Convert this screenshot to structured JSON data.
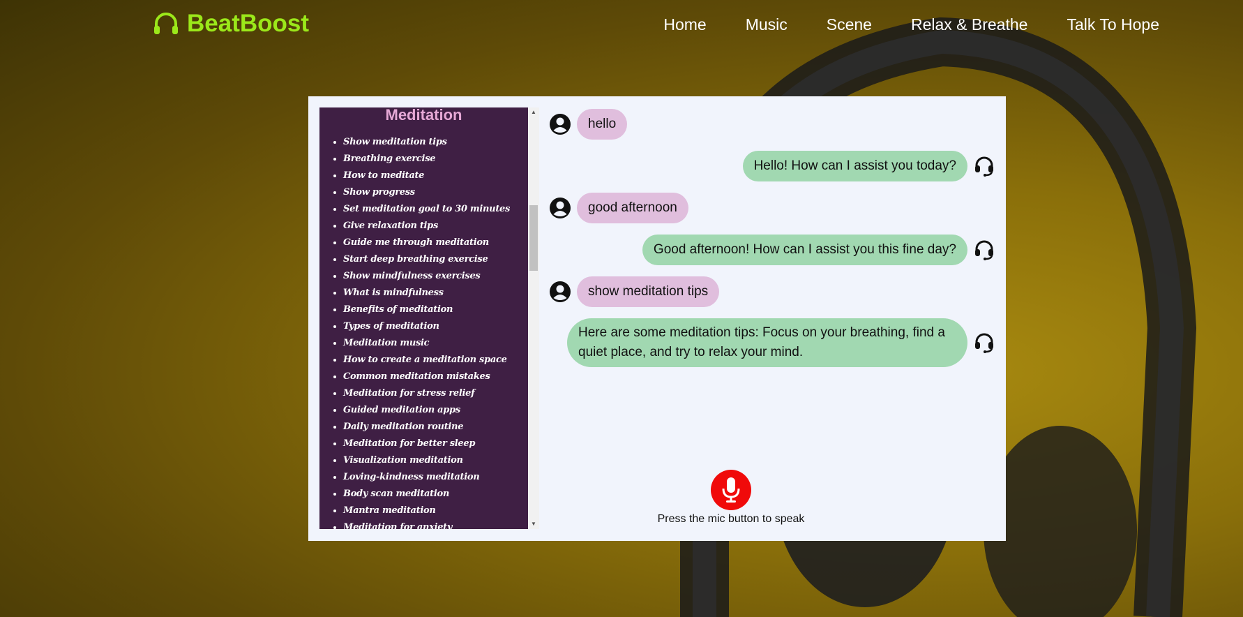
{
  "app": {
    "name": "BeatBoost",
    "logo_icon": "headphones-icon",
    "brand_color": "#9be81a"
  },
  "nav": {
    "items": [
      {
        "label": "Home"
      },
      {
        "label": "Music"
      },
      {
        "label": "Scene"
      },
      {
        "label": "Relax & Breathe"
      },
      {
        "label": "Talk To Hope"
      }
    ]
  },
  "sidebar": {
    "title": "Meditation",
    "items": [
      "Show meditation tips",
      "Breathing exercise",
      "How to meditate",
      "Show progress",
      "Set meditation goal to 30 minutes",
      "Give relaxation tips",
      "Guide me through meditation",
      "Start deep breathing exercise",
      "Show mindfulness exercises",
      "What is mindfulness",
      "Benefits of meditation",
      "Types of meditation",
      "Meditation music",
      "How to create a meditation space",
      "Common meditation mistakes",
      "Meditation for stress relief",
      "Guided meditation apps",
      "Daily meditation routine",
      "Meditation for better sleep",
      "Visualization meditation",
      "Loving-kindness meditation",
      "Body scan meditation",
      "Mantra meditation",
      "Meditation for anxiety"
    ]
  },
  "chat": {
    "messages": [
      {
        "from": "user",
        "text": "hello",
        "icon": "user-avatar-icon"
      },
      {
        "from": "bot",
        "text": "Hello! How can I assist you today?",
        "icon": "headset-icon"
      },
      {
        "from": "user",
        "text": "good afternoon",
        "icon": "user-avatar-icon"
      },
      {
        "from": "bot",
        "text": "Good afternoon! How can I assist you this fine day?",
        "icon": "headset-icon"
      },
      {
        "from": "user",
        "text": "show meditation tips",
        "icon": "user-avatar-icon"
      },
      {
        "from": "bot",
        "text": "Here are some meditation tips: Focus on your breathing, find a quiet place, and try to relax your mind.",
        "icon": "headset-icon"
      }
    ],
    "user_bubble_color": "#e0bedd",
    "bot_bubble_color": "#a1d8b1"
  },
  "mic": {
    "icon": "microphone-icon",
    "hint": "Press the mic button to speak",
    "color": "#f00a0a"
  }
}
